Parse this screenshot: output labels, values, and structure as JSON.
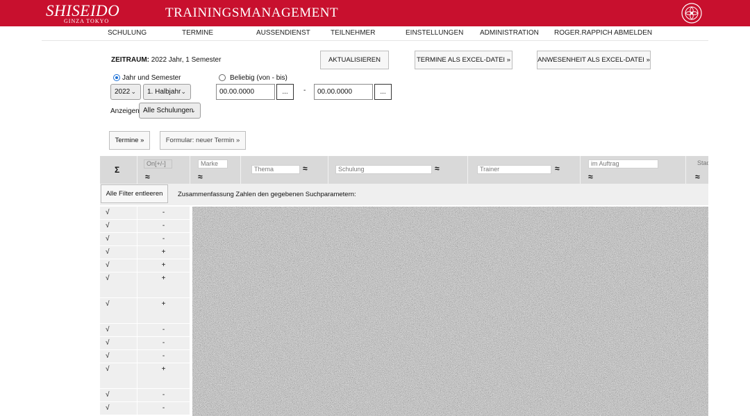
{
  "header": {
    "logo": "SHISEIDO",
    "logo_sub": "GINZA TOKYO",
    "title": "TRAININGSMANAGEMENT",
    "brand_color": "#c8102e"
  },
  "nav": [
    "SCHULUNG",
    "TERMINE",
    "AUSSENDIENST",
    "TEILNEHMER",
    "EINSTELLUNGEN",
    "ADMINISTRATION",
    "ROGER.RAPPICH ABMELDEN"
  ],
  "period": {
    "label": "ZEITRAUM:",
    "value": "2022 Jahr, 1 Semester"
  },
  "buttons": {
    "refresh": "AKTUALISIEREN",
    "export_termine": "TERMINE ALS EXCEL-DATEI »",
    "export_attendance": "ANWESENHEIT ALS EXCEL-DATEI »",
    "termine": "Termine »",
    "new_termin": "Formular: neuer Termin »",
    "clear_filters": "Alle Filter entleeren"
  },
  "filters": {
    "radio_year": "Jahr und Semester",
    "radio_any": "Beliebig (von - bis)",
    "year": "2022",
    "half": "1. Halbjahr",
    "date_from": "00.00.0000",
    "date_to": "00.00.0000",
    "dots": "...",
    "date_sep": "-",
    "show_label": "Anzeigen",
    "show_value": "Alle Schulungen"
  },
  "table": {
    "sum_symbol": "Σ",
    "approx_symbol": "≈",
    "columns": [
      "On[+/-]",
      "Marke",
      "Thema",
      "Schulung",
      "Trainer",
      "im Auftrag",
      "Stad"
    ],
    "summary": "Zusammenfassung Zahlen den gegebenen Suchparametern:",
    "rows": [
      {
        "check": "√",
        "status": "-"
      },
      {
        "check": "√",
        "status": "-"
      },
      {
        "check": "√",
        "status": "-"
      },
      {
        "check": "√",
        "status": "+"
      },
      {
        "check": "√",
        "status": "+"
      },
      {
        "check": "√",
        "status": "+"
      },
      {
        "check": "√",
        "status": "+"
      },
      {
        "check": "√",
        "status": "-"
      },
      {
        "check": "√",
        "status": "-"
      },
      {
        "check": "√",
        "status": "-"
      },
      {
        "check": "√",
        "status": "+"
      },
      {
        "check": "√",
        "status": "-"
      },
      {
        "check": "√",
        "status": "-"
      }
    ]
  }
}
